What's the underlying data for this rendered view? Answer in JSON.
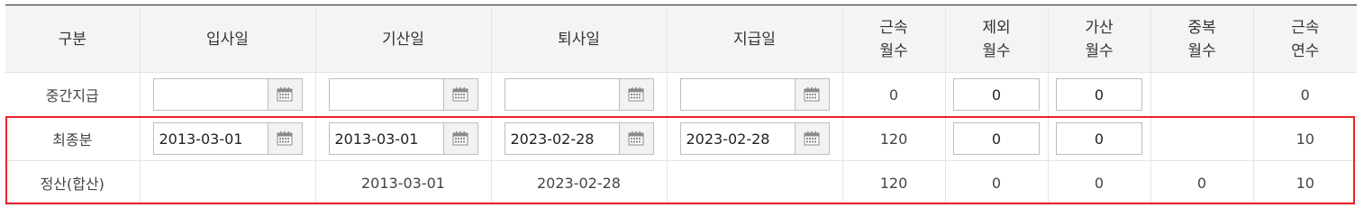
{
  "headers": {
    "category": "구분",
    "join_date": "입사일",
    "start_date": "기산일",
    "retire_date": "퇴사일",
    "pay_date": "지급일",
    "service_months": [
      "근속",
      "월수"
    ],
    "excluded_months": [
      "제외",
      "월수"
    ],
    "added_months": [
      "가산",
      "월수"
    ],
    "overlap_months": [
      "중복",
      "월수"
    ],
    "service_years": [
      "근속",
      "연수"
    ]
  },
  "rows": {
    "interim": {
      "label": "중간지급",
      "join_date": "",
      "start_date": "",
      "retire_date": "",
      "pay_date": "",
      "service_months": "0",
      "excluded_months": "0",
      "added_months": "0",
      "overlap_months": "",
      "service_years": "0"
    },
    "final": {
      "label": "최종분",
      "join_date": "2013-03-01",
      "start_date": "2013-03-01",
      "retire_date": "2023-02-28",
      "pay_date": "2023-02-28",
      "service_months": "120",
      "excluded_months": "0",
      "added_months": "0",
      "overlap_months": "",
      "service_years": "10"
    },
    "settlement": {
      "label": "정산(합산)",
      "join_date": "",
      "start_date": "2013-03-01",
      "retire_date": "2023-02-28",
      "pay_date": "",
      "service_months": "120",
      "excluded_months": "0",
      "added_months": "0",
      "overlap_months": "0",
      "service_years": "10"
    }
  },
  "icons": {
    "calendar": "calendar-icon"
  },
  "colors": {
    "highlight": "#e8232b",
    "header_bg": "#f4f4f4",
    "border": "#e4e4e4"
  }
}
